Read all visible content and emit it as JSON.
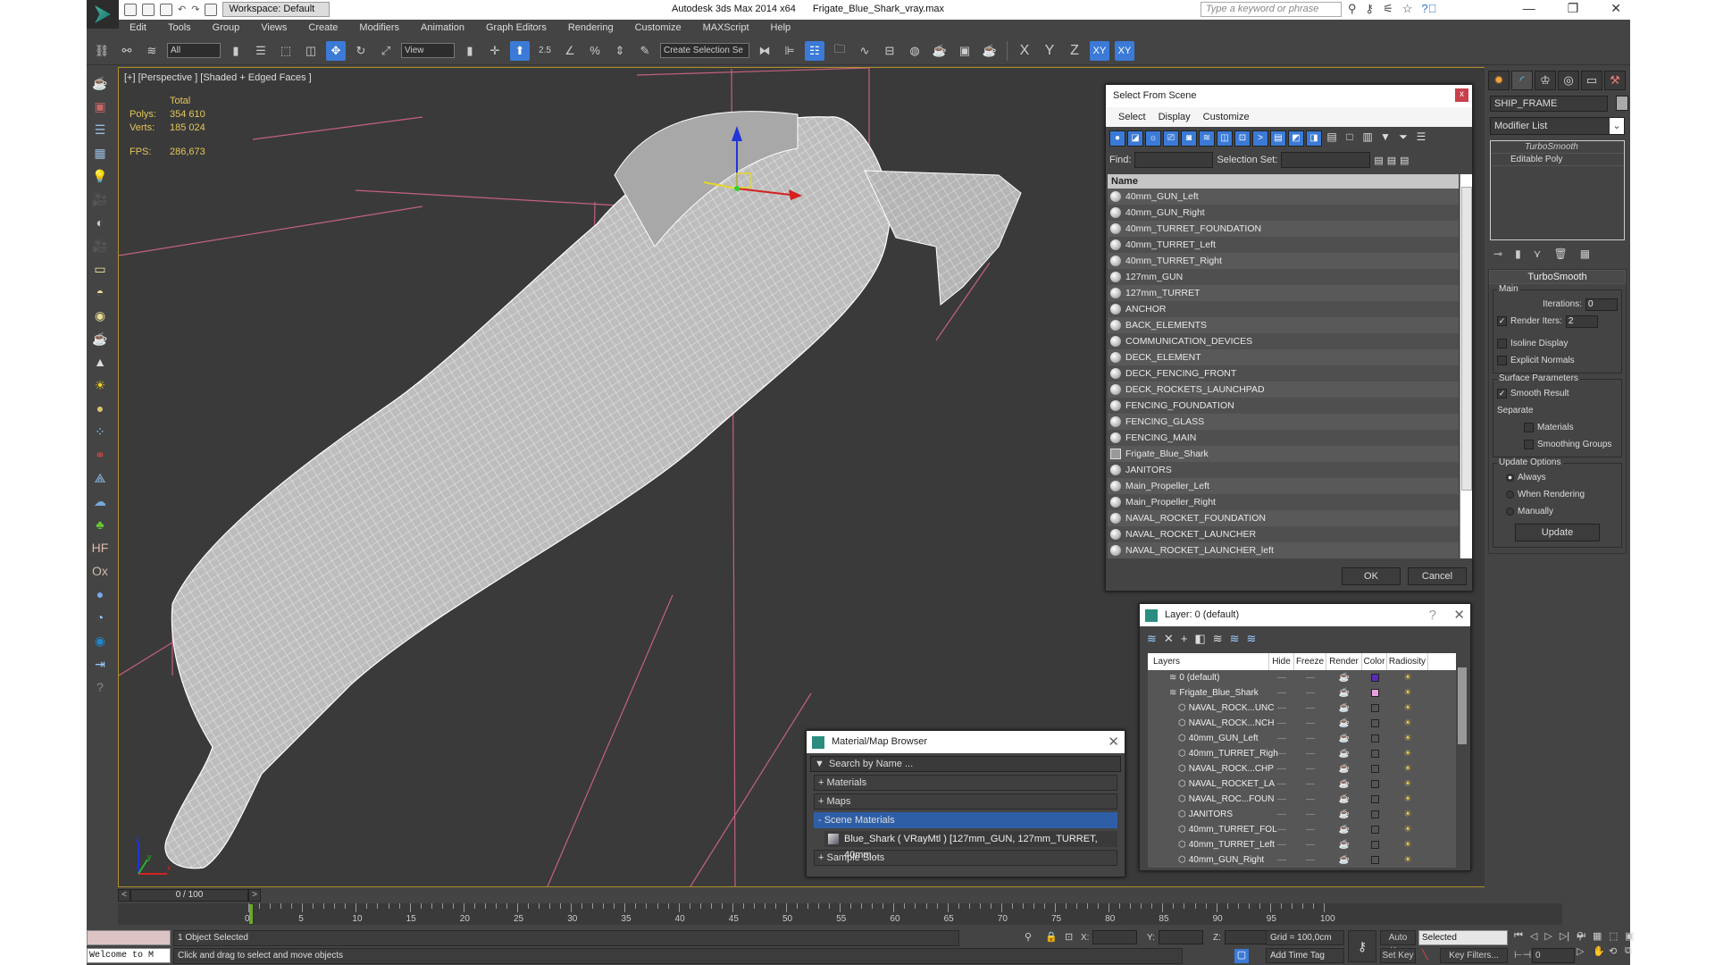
{
  "window": {
    "app_title": "Autodesk 3ds Max  2014 x64",
    "file_name": "Frigate_Blue_Shark_vray.max",
    "workspace": "Workspace: Default",
    "help_search_placeholder": "Type a keyword or phrase"
  },
  "menu": [
    "Edit",
    "Tools",
    "Group",
    "Views",
    "Create",
    "Modifiers",
    "Animation",
    "Graph Editors",
    "Rendering",
    "Customize",
    "MAXScript",
    "Help"
  ],
  "toolbar": {
    "selection_filter": "All",
    "ref_coord": "View",
    "snap_angle": "2.5",
    "named_selection_placeholder": "Create Selection Se",
    "axis_x": "X",
    "axis_y": "Y",
    "axis_z": "Z",
    "axis_xy": "XY",
    "axis_xy2": "XY"
  },
  "viewport": {
    "label": "[+] [Perspective ] [Shaded + Edged Faces ]",
    "stats": {
      "header": "Total",
      "polys_label": "Polys:",
      "polys": "354 610",
      "verts_label": "Verts:",
      "verts": "185 024",
      "fps_label": "FPS:",
      "fps": "286,673"
    },
    "axis": {
      "x": "x",
      "y": "y",
      "z": "z"
    }
  },
  "select_from_scene": {
    "title": "Select From Scene",
    "close": "x",
    "menu": [
      "Select",
      "Display",
      "Customize"
    ],
    "find_label": "Find:",
    "selection_set_label": "Selection Set:",
    "column_name": "Name",
    "items": [
      {
        "name": "40mm_GUN_Left",
        "type": "geometry"
      },
      {
        "name": "40mm_GUN_Right",
        "type": "geometry"
      },
      {
        "name": "40mm_TURRET_FOUNDATION",
        "type": "geometry"
      },
      {
        "name": "40mm_TURRET_Left",
        "type": "geometry"
      },
      {
        "name": "40mm_TURRET_Right",
        "type": "geometry"
      },
      {
        "name": "127mm_GUN",
        "type": "geometry"
      },
      {
        "name": "127mm_TURRET",
        "type": "geometry"
      },
      {
        "name": "ANCHOR",
        "type": "geometry"
      },
      {
        "name": "BACK_ELEMENTS",
        "type": "geometry"
      },
      {
        "name": "COMMUNICATION_DEVICES",
        "type": "geometry"
      },
      {
        "name": "DECK_ELEMENT",
        "type": "geometry"
      },
      {
        "name": "DECK_FENCING_FRONT",
        "type": "geometry"
      },
      {
        "name": "DECK_ROCKETS_LAUNCHPAD",
        "type": "geometry"
      },
      {
        "name": "FENCING_FOUNDATION",
        "type": "geometry"
      },
      {
        "name": "FENCING_GLASS",
        "type": "geometry"
      },
      {
        "name": "FENCING_MAIN",
        "type": "geometry"
      },
      {
        "name": "Frigate_Blue_Shark",
        "type": "group"
      },
      {
        "name": "JANITORS",
        "type": "geometry"
      },
      {
        "name": "Main_Propeller_Left",
        "type": "geometry"
      },
      {
        "name": "Main_Propeller_Right",
        "type": "geometry"
      },
      {
        "name": "NAVAL_ROCKET_FOUNDATION",
        "type": "geometry"
      },
      {
        "name": "NAVAL_ROCKET_LAUNCHER",
        "type": "geometry"
      },
      {
        "name": "NAVAL_ROCKET_LAUNCHER_left",
        "type": "geometry"
      }
    ],
    "ok": "OK",
    "cancel": "Cancel"
  },
  "command_panel": {
    "object_name": "SHIP_FRAME",
    "modifier_list": "Modifier List",
    "stack": [
      "TurboSmooth",
      "Editable Poly"
    ],
    "rollout_title": "TurboSmooth",
    "main_group": "Main",
    "iterations_label": "Iterations:",
    "iterations": "0",
    "render_iters_label": "Render Iters:",
    "render_iters": "2",
    "render_iters_checked": true,
    "isoline_label": "Isoline Display",
    "isoline_checked": false,
    "explicit_normals_label": "Explicit Normals",
    "explicit_normals_checked": false,
    "surface_group": "Surface Parameters",
    "smooth_result_label": "Smooth Result",
    "smooth_result_checked": true,
    "separate_label": "Separate",
    "materials_label": "Materials",
    "smoothing_groups_label": "Smoothing Groups",
    "update_group": "Update Options",
    "update_options": [
      "Always",
      "When Rendering",
      "Manually"
    ],
    "update_selected": "Always",
    "update_button": "Update"
  },
  "layer_dialog": {
    "title": "Layer: 0 (default)",
    "help": "?",
    "columns": [
      "Layers",
      "Hide",
      "Freeze",
      "Render",
      "Color",
      "Radiosity"
    ],
    "rows": [
      {
        "name": "0 (default)",
        "color": "#5a2bb5",
        "level": 0
      },
      {
        "name": "Frigate_Blue_Shark",
        "color": "#e7a0de",
        "level": 0
      },
      {
        "name": "NAVAL_ROCK...UNC",
        "color": "#555555",
        "level": 1
      },
      {
        "name": "NAVAL_ROCK...NCH",
        "color": "#555555",
        "level": 1
      },
      {
        "name": "40mm_GUN_Left",
        "color": "#555555",
        "level": 1
      },
      {
        "name": "40mm_TURRET_Righ",
        "color": "#555555",
        "level": 1
      },
      {
        "name": "NAVAL_ROCK...CHP",
        "color": "#555555",
        "level": 1
      },
      {
        "name": "NAVAL_ROCKET_LA",
        "color": "#555555",
        "level": 1
      },
      {
        "name": "NAVAL_ROC...FOUN",
        "color": "#555555",
        "level": 1
      },
      {
        "name": "JANITORS",
        "color": "#555555",
        "level": 1
      },
      {
        "name": "40mm_TURRET_FOL",
        "color": "#555555",
        "level": 1
      },
      {
        "name": "40mm_TURRET_Left",
        "color": "#555555",
        "level": 1
      },
      {
        "name": "40mm_GUN_Right",
        "color": "#555555",
        "level": 1
      }
    ]
  },
  "material_browser": {
    "title": "Material/Map Browser",
    "search_placeholder": "Search by Name ...",
    "categories": [
      "+ Materials",
      "+ Maps",
      "- Scene Materials"
    ],
    "scene_material": "Blue_Shark  ( VRayMtl )  [127mm_GUN, 127mm_TURRET, 40mm...",
    "sample_slots": "+ Sample Slots"
  },
  "timeline": {
    "slider": "0 / 100",
    "ticks": [
      "0",
      "5",
      "10",
      "15",
      "20",
      "25",
      "30",
      "35",
      "40",
      "45",
      "50",
      "55",
      "60",
      "65",
      "70",
      "75",
      "80",
      "85",
      "90",
      "95",
      "100"
    ]
  },
  "status": {
    "welcome": "Welcome to M",
    "selection": "1 Object Selected",
    "prompt": "Click and drag to select and move objects",
    "x_label": "X:",
    "y_label": "Y:",
    "z_label": "Z:",
    "grid": "Grid = 100,0cm",
    "add_time_tag": "Add Time Tag",
    "auto_key": "Auto Key",
    "set_key": "Set Key",
    "key_mode": "Selected",
    "key_filters": "Key Filters...",
    "current_frame": "0"
  }
}
